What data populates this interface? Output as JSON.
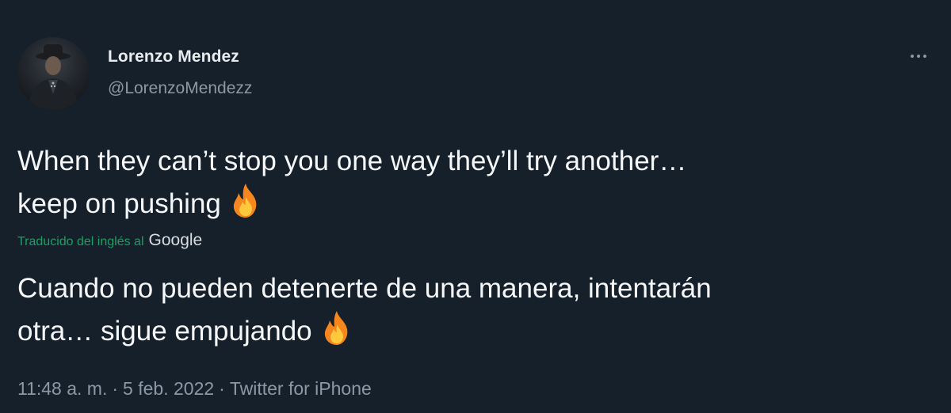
{
  "author": {
    "display_name": "Lorenzo Mendez",
    "handle": "@LorenzoMendezz"
  },
  "tweet": {
    "text_line1": "When they can’t stop you one way they’ll try another…",
    "text_line2": "keep on pushing",
    "emoji": "fire-icon"
  },
  "translation": {
    "label": "Traducido del inglés al",
    "provider": "Google",
    "text_line1": "Cuando no pueden detenerte de una manera, intentarán",
    "text_line2": "otra… sigue empujando"
  },
  "meta": {
    "time": "11:48 a. m.",
    "date": "5 feb. 2022",
    "source": "Twitter for iPhone",
    "separator": "·"
  },
  "colors": {
    "background": "#15202b",
    "text": "#f5f7f9",
    "secondary": "#8b98a5",
    "translation_accent": "#1d9e63"
  }
}
